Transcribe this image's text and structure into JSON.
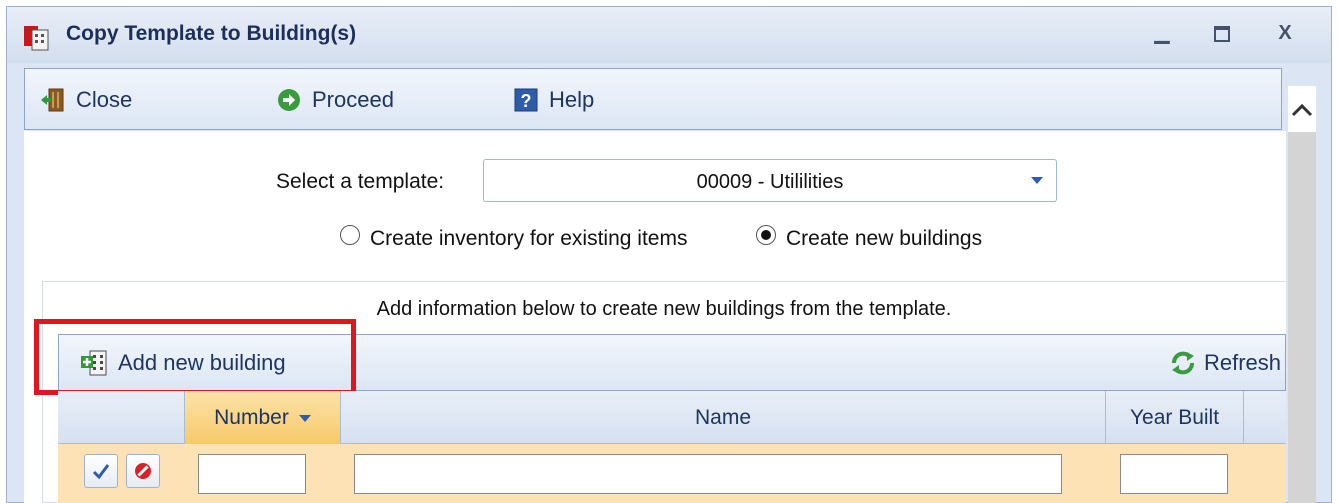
{
  "window": {
    "title": "Copy Template to Building(s)",
    "controls": [
      "minimize",
      "maximize",
      "close"
    ],
    "close_glyph": "X"
  },
  "toolbar": {
    "close_label": "Close",
    "proceed_label": "Proceed",
    "help_label": "Help"
  },
  "form": {
    "template_label": "Select a template:",
    "template_value": "00009 - Utililities",
    "radio_existing_label": "Create inventory for existing items",
    "radio_new_label": "Create new buildings",
    "radio_selected": "new"
  },
  "grid": {
    "info_text": "Add information below to create new buildings from the template.",
    "add_label": "Add new building",
    "refresh_label": "Refresh",
    "columns": [
      "Number",
      "Name",
      "Year Built"
    ],
    "sorted_column": "Number",
    "edit_row": {
      "number": "",
      "name": "",
      "year_built": ""
    }
  },
  "colors": {
    "title_text": "#1b2f5a",
    "highlight_box": "#e0161f",
    "sorted_header": "#f7c96a",
    "edit_row": "#fde2b6"
  },
  "icons": [
    "app-icon",
    "door-exit-icon",
    "arrow-right-circle-icon",
    "help-icon",
    "add-building-icon",
    "refresh-icon",
    "check-icon",
    "cancel-icon",
    "chevron-up-icon"
  ]
}
